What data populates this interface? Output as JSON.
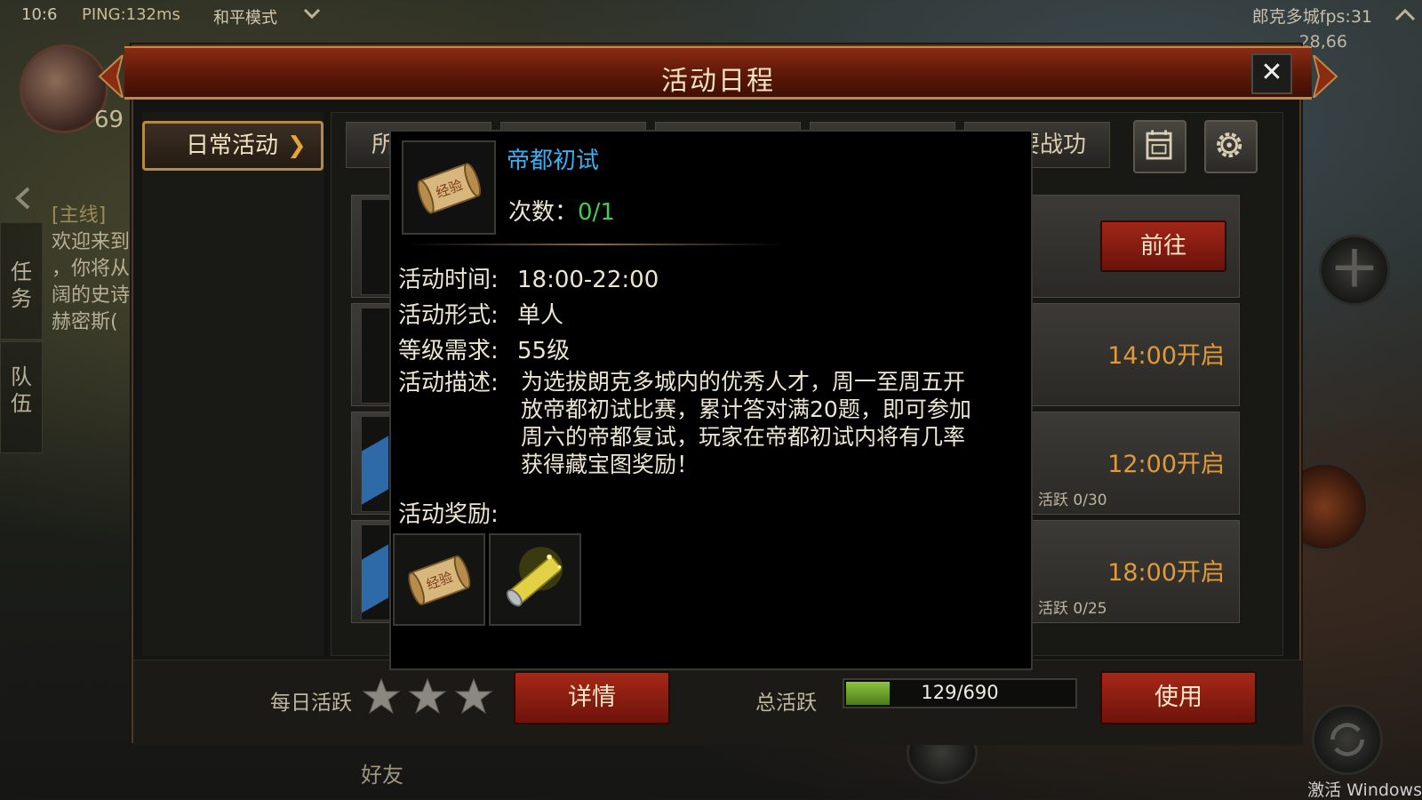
{
  "hud": {
    "time": "10:6",
    "ping": "PING:132ms",
    "mode": "和平模式",
    "fps": "郎克多城fps:31",
    "coord": "28,66",
    "level": "69"
  },
  "side_tabs": {
    "task": "任务",
    "team": "队伍"
  },
  "quest": {
    "tag": "[主线]",
    "lines": [
      "欢迎来到",
      "，你将从",
      "阔的史诗",
      "赫密斯("
    ]
  },
  "friends_label": "好友",
  "watermark": "激活 Windows",
  "dialog": {
    "title": "活动日程",
    "close": "✕",
    "nav_daily": "日常活动",
    "nav_chevron": "❯",
    "tabs": [
      "所",
      "",
      "",
      "",
      "要战功"
    ],
    "rows": [
      {
        "action": "前往",
        "type": "button"
      },
      {
        "time": "14:00开启",
        "type": "time"
      },
      {
        "time": "12:00开启",
        "active": "活跃 0/30",
        "type": "time"
      },
      {
        "time": "18:00开启",
        "active": "活跃 0/25",
        "type": "time"
      }
    ]
  },
  "bottom": {
    "daily_active_label": "每日活跃",
    "detail_button": "详情",
    "total_active_label": "总活跃",
    "progress_text": "129/690",
    "progress_fraction": 0.187,
    "use_button": "使用"
  },
  "popup": {
    "title": "帝都初试",
    "count_label": "次数：",
    "count_value": "0/1",
    "time_key": "活动时间:",
    "time_value": "18:00-22:00",
    "form_key": "活动形式:",
    "form_value": "单人",
    "level_key": "等级需求:",
    "level_value": "55级",
    "desc_key": "活动描述:",
    "desc_lines": [
      "为选拔朗克多城内的优秀人才，周一至周五开",
      "放帝都初试比赛，累计答对满20题，即可参加",
      "周六的帝都复试，玩家在帝都初试内将有几率",
      "获得藏宝图奖励！"
    ],
    "reward_key": "活动奖励:",
    "scroll_text": "经验"
  },
  "colors": {
    "title_bar": "#6e1d0a",
    "accent_gold": "#b68948",
    "time_orange": "#e09a3a",
    "popup_title_blue": "#3ab0f0",
    "count_green": "#44cc50",
    "button_red": "#a62818"
  }
}
